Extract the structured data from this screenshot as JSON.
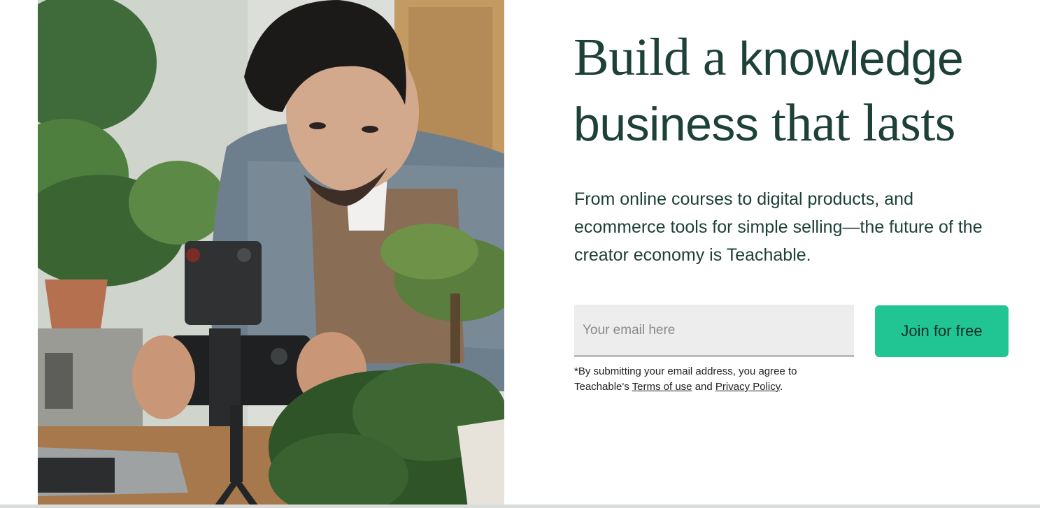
{
  "hero": {
    "headline": {
      "part1": "Build a ",
      "part2": "knowledge",
      "part3": "business",
      "part4": " that lasts"
    },
    "subcopy": "From online courses to digital products, and ecommerce tools for simple selling—the future of the creator economy is Teachable.",
    "image_description_icon": "creator-filming-plants-photo"
  },
  "signup": {
    "email_placeholder": "Your email here",
    "button_label": "Join for free",
    "disclaimer_prefix": "*By submitting your email address, you agree to Teachable's ",
    "terms_label": "Terms of use",
    "and_text": " and ",
    "privacy_label": "Privacy Policy",
    "suffix": "."
  },
  "colors": {
    "brand_dark": "#1d4038",
    "cta_green": "#21c493",
    "field_bg": "#ededed"
  }
}
